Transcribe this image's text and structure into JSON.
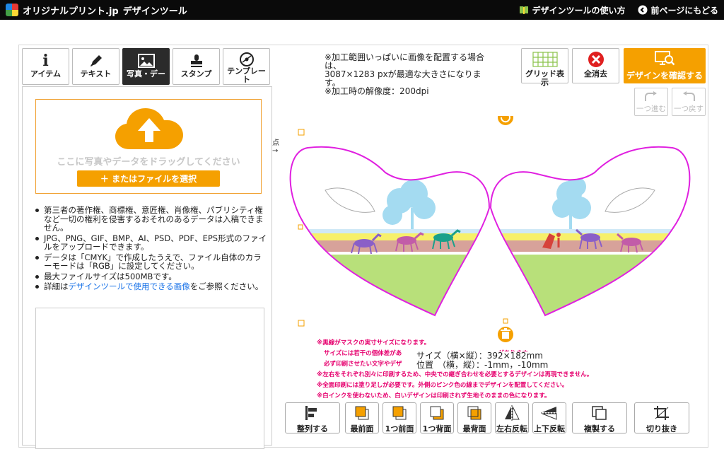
{
  "header": {
    "logo_text": "オリジナルプリント.jp",
    "tool_name": "デザインツール",
    "howto_link": "デザインツールの使い方",
    "back_link": "前ページにもどる"
  },
  "tabs": [
    {
      "label": "アイテム",
      "icon": "info-icon"
    },
    {
      "label": "テキスト",
      "icon": "pen-icon"
    },
    {
      "label": "写真・デー",
      "icon": "image-icon",
      "active": true
    },
    {
      "label": "スタンプ",
      "icon": "stamp-icon"
    },
    {
      "label": "テンプレート",
      "icon": "template-icon"
    }
  ],
  "upload": {
    "drop_text": "ここに写真やデータをドラッグしてください",
    "select_button": "＋ またはファイルを選択"
  },
  "notes": [
    "第三者の著作権、商標権、意匠権、肖像権、パブリシティ権など一切の権利を侵害するおそれのあるデータは入稿できません。",
    "JPG、PNG、GIF、BMP、AI、PSD、PDF、EPS形式のファイルをアップロードできます。",
    "データは「CMYK」で作成したうえで、ファイル自体のカラーモードは「RGB」に設定してください。",
    "最大ファイルサイズは500MBです。"
  ],
  "notes_last": {
    "prefix": "詳細は",
    "link": "デザインツールで使用できる画像",
    "suffix": "をご参照ください。"
  },
  "print_info": {
    "line1": "※加工範囲いっぱいに画像を配置する場合は、",
    "line2": "3087×1283 pxが最適な大きさになります。",
    "line3": "※加工時の解像度：200dpi"
  },
  "right_buttons": {
    "grid": "グリッド表示",
    "clear": "全消去",
    "confirm": "デザインを確認する",
    "redo": "一つ進む",
    "undo": "一つ戻す"
  },
  "side_label": "点\n→",
  "warnings": [
    "※黒線がマスクの実寸サイズになります。",
    "サイズには若干の個体差があ　　　　　　　　　　　　　　　　があります。",
    "必ず印刷させたい文字やデザ",
    "※左右をそれぞれ別々に印刷するため、中央での継ぎ合わせを必要とするデザインは再現できません。",
    "※全面印刷には塗り足しが必要です。外側のピンク色の線までデザインを配置してください。",
    "※白インクを使わないため、白いデザインは印刷されず生地そのままの色になります。"
  ],
  "size_info": {
    "size_label": "サイズ（横×縦）",
    "size_value": "：392×182mm",
    "pos_label": "位置　（横，縦）",
    "pos_value": "：-1mm，-10mm"
  },
  "bottom_buttons": [
    {
      "label": "整列する",
      "icon": "align-icon"
    },
    {
      "label": "最前面",
      "icon": "bring-front-icon"
    },
    {
      "label": "1つ前面",
      "icon": "bring-forward-icon"
    },
    {
      "label": "1つ背面",
      "icon": "send-backward-icon"
    },
    {
      "label": "最背面",
      "icon": "send-back-icon"
    },
    {
      "label": "左右反転",
      "icon": "flip-horizontal-icon"
    },
    {
      "label": "上下反転",
      "icon": "flip-vertical-icon"
    },
    {
      "label": "複製する",
      "icon": "duplicate-icon"
    },
    {
      "label": "切り抜き",
      "icon": "crop-icon"
    }
  ],
  "colors": {
    "accent": "#f5a000",
    "mask_outline": "#e020e0",
    "clear_red": "#e02020",
    "warning_text": "#e6006e",
    "link": "#1a73e8"
  }
}
